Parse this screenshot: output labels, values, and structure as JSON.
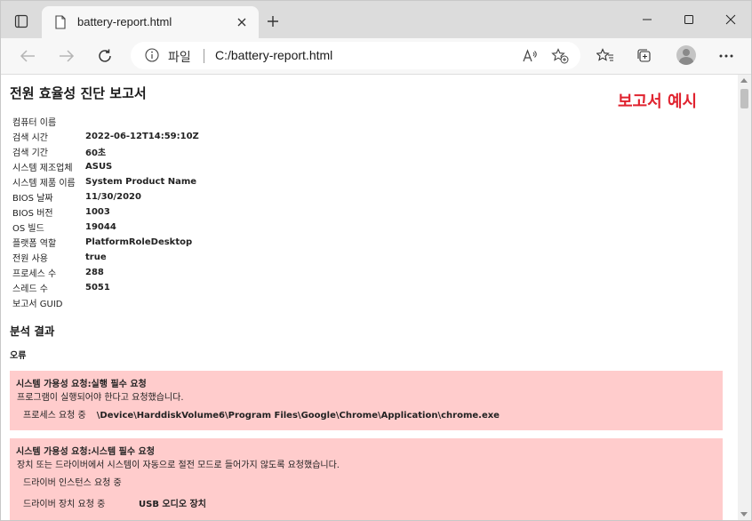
{
  "browser": {
    "tab_title": "battery-report.html",
    "address_scheme": "파일",
    "address_url": "C:/battery-report.html"
  },
  "report": {
    "title": "전원 효율성 진단 보고서",
    "sample_label": "보고서 예시",
    "info": [
      {
        "key": "컴퓨터 이름",
        "value": ""
      },
      {
        "key": "검색 시간",
        "value": "2022-06-12T14:59:10Z"
      },
      {
        "key": "검색 기간",
        "value": "60초"
      },
      {
        "key": "시스템 제조업체",
        "value": "ASUS"
      },
      {
        "key": "시스템 제품 이름",
        "value": "System Product Name"
      },
      {
        "key": "BIOS 날짜",
        "value": "11/30/2020"
      },
      {
        "key": "BIOS 버전",
        "value": "1003"
      },
      {
        "key": "OS 빌드",
        "value": "19044"
      },
      {
        "key": "플랫폼 역할",
        "value": "PlatformRoleDesktop"
      },
      {
        "key": "전원 사용",
        "value": "true"
      },
      {
        "key": "프로세스 수",
        "value": "288"
      },
      {
        "key": "스레드 수",
        "value": "5051"
      },
      {
        "key": "보고서 GUID",
        "value": ""
      }
    ],
    "analysis_title": "분석 결과",
    "errors_title": "오류",
    "errors": [
      {
        "title": "시스템 가용성 요청:실행 필수 요청",
        "desc": "프로그램이 실행되어야 한다고 요청했습니다.",
        "rows": [
          {
            "key": "프로세스 요청 중",
            "value": "\\Device\\HarddiskVolume6\\Program Files\\Google\\Chrome\\Application\\chrome.exe"
          }
        ]
      },
      {
        "title": "시스템 가용성 요청:시스템 필수 요청",
        "desc": "장치 또는 드라이버에서 시스템이 자동으로 절전 모드로 들어가지 않도록 요청했습니다.",
        "rows": [
          {
            "key": "드라이버 인스턴스 요청 중",
            "value": ""
          },
          {
            "key": "드라이버 장치 요청 중",
            "value": "USB 오디오 장치"
          }
        ]
      }
    ]
  },
  "colors": {
    "error_bg": "#ffcccc",
    "sample_label": "#e0232f"
  }
}
